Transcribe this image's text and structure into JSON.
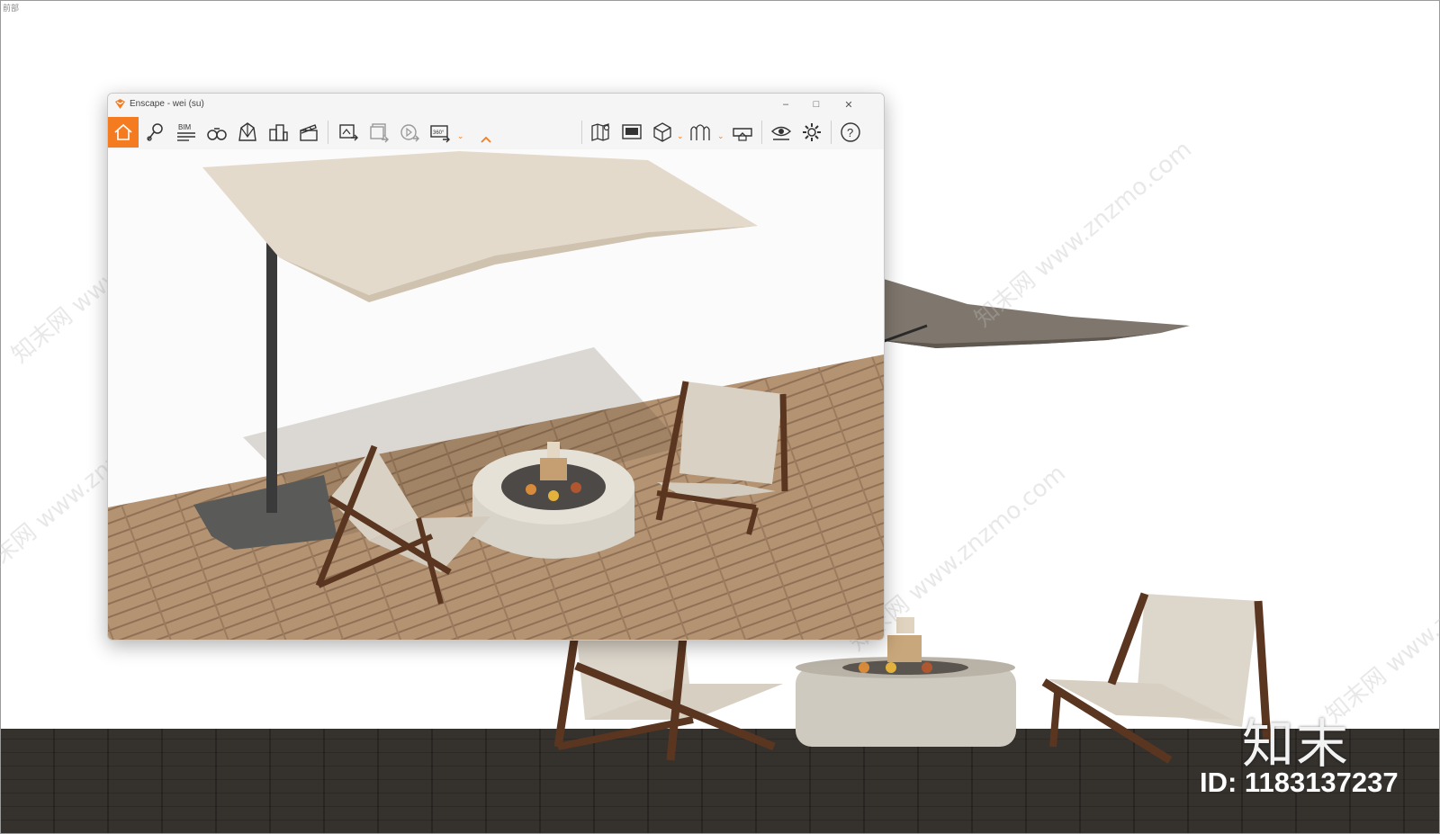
{
  "page": {
    "corner_label": "前部"
  },
  "window": {
    "title": "Enscape - wei (su)",
    "controls": {
      "minimize": "–",
      "maximize": "□",
      "close": "✕"
    }
  },
  "toolbar": {
    "accent": "#f47b20",
    "left_icons": [
      "home-icon",
      "pin-icon",
      "bim-icon",
      "binoculars-icon",
      "perspective-icon",
      "buildings-icon",
      "clapperboard-icon"
    ],
    "bim_label": "BIM",
    "export_icons": [
      "screenshot-icon",
      "batch-render-icon",
      "video-icon",
      "panorama-icon"
    ],
    "panorama_label": "360°",
    "right_icons": [
      "map-icon",
      "monitor-icon",
      "cube-icon",
      "arches-icon",
      "vr-headset-icon",
      "eye-icon",
      "settings-icon",
      "help-icon"
    ],
    "help_label": "?"
  },
  "watermark": {
    "text": "知末网 www.znzmo.com"
  },
  "footer": {
    "brand": "知末",
    "id_text": "ID: 1183137237"
  }
}
